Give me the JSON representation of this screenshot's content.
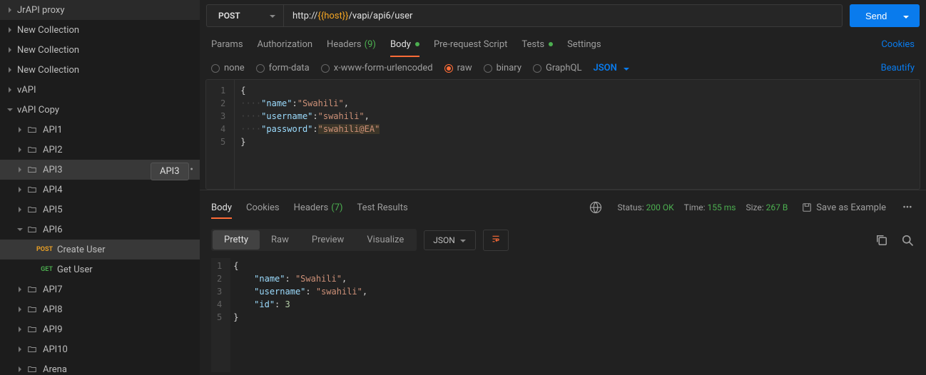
{
  "sidebar": {
    "items": [
      {
        "type": "collection",
        "label": "JrAPI proxy",
        "expanded": false,
        "indent": 0
      },
      {
        "type": "collection",
        "label": "New Collection",
        "expanded": false,
        "indent": 0
      },
      {
        "type": "collection",
        "label": "New Collection",
        "expanded": false,
        "indent": 0
      },
      {
        "type": "collection",
        "label": "New Collection",
        "expanded": false,
        "indent": 0
      },
      {
        "type": "collection",
        "label": "vAPI",
        "expanded": false,
        "indent": 0
      },
      {
        "type": "collection",
        "label": "vAPI Copy",
        "expanded": true,
        "indent": 0
      },
      {
        "type": "folder",
        "label": "API1",
        "expanded": false,
        "indent": 1
      },
      {
        "type": "folder",
        "label": "API2",
        "expanded": false,
        "indent": 1
      },
      {
        "type": "folder",
        "label": "API3",
        "expanded": false,
        "indent": 1,
        "active": true,
        "more": true
      },
      {
        "type": "folder",
        "label": "API4",
        "expanded": false,
        "indent": 1
      },
      {
        "type": "folder",
        "label": "API5",
        "expanded": false,
        "indent": 1
      },
      {
        "type": "folder",
        "label": "API6",
        "expanded": true,
        "indent": 1
      },
      {
        "type": "request",
        "method": "POST",
        "label": "Create User",
        "indent": 2,
        "selected": true
      },
      {
        "type": "request",
        "method": "GET",
        "label": "Get User",
        "indent": 2
      },
      {
        "type": "folder",
        "label": "API7",
        "expanded": false,
        "indent": 1
      },
      {
        "type": "folder",
        "label": "API8",
        "expanded": false,
        "indent": 1
      },
      {
        "type": "folder",
        "label": "API9",
        "expanded": false,
        "indent": 1
      },
      {
        "type": "folder",
        "label": "API10",
        "expanded": false,
        "indent": 1
      },
      {
        "type": "folder",
        "label": "Arena",
        "expanded": false,
        "indent": 1
      }
    ],
    "tooltip": "API3"
  },
  "request": {
    "method": "POST",
    "url_prefix": "http://",
    "url_var": "{{host}}",
    "url_path": "/vapi/api6/user",
    "send_label": "Send",
    "tabs": [
      "Params",
      "Authorization",
      "Headers",
      "Body",
      "Pre-request Script",
      "Tests",
      "Settings"
    ],
    "headers_count": "(9)",
    "active_tab": "Body",
    "cookies_link": "Cookies",
    "body_types": [
      "none",
      "form-data",
      "x-www-form-urlencoded",
      "raw",
      "binary",
      "GraphQL"
    ],
    "body_type_active": "raw",
    "body_format": "JSON",
    "beautify_link": "Beautify",
    "editor": {
      "lines": [
        "{",
        "····\"name\":\"Swahili\",",
        "····\"username\":\"swahili\",",
        "····\"password\":\"swahili@EA\"",
        "}"
      ],
      "name_key": "\"name\"",
      "name_val": "\"Swahili\"",
      "username_key": "\"username\"",
      "username_val": "\"swahili\"",
      "password_key": "\"password\"",
      "password_val": "\"swahili@EA\""
    }
  },
  "response": {
    "tabs": [
      "Body",
      "Cookies",
      "Headers",
      "Test Results"
    ],
    "headers_count": "(7)",
    "active_tab": "Body",
    "status_label": "Status:",
    "status_value": "200 OK",
    "time_label": "Time:",
    "time_value": "155 ms",
    "size_label": "Size:",
    "size_value": "267 B",
    "save_example": "Save as Example",
    "view_tabs": [
      "Pretty",
      "Raw",
      "Preview",
      "Visualize"
    ],
    "view_active": "Pretty",
    "format": "JSON",
    "editor": {
      "name_key": "\"name\"",
      "name_val": "\"Swahili\"",
      "username_key": "\"username\"",
      "username_val": "\"swahili\"",
      "id_key": "\"id\"",
      "id_val": "3"
    }
  }
}
